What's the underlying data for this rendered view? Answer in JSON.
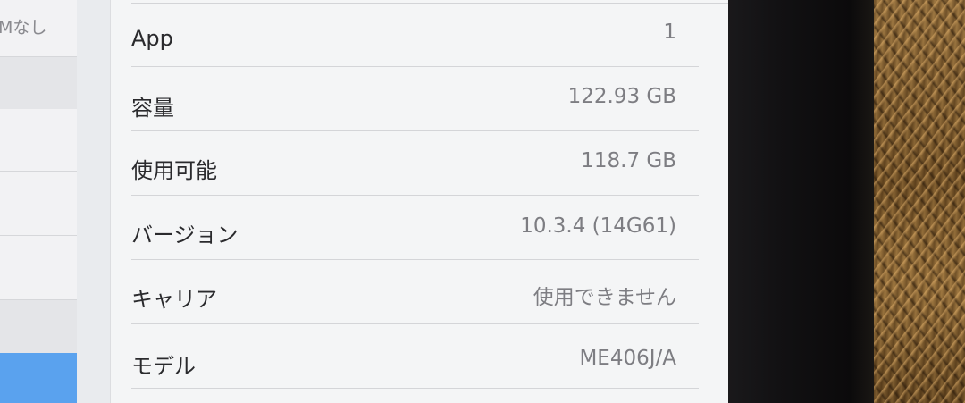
{
  "master_pane": {
    "visible_row_text": "Mなし"
  },
  "about": {
    "rows": [
      {
        "label": "App",
        "value": "1"
      },
      {
        "label": "容量",
        "value": "122.93 GB"
      },
      {
        "label": "使用可能",
        "value": "118.7 GB"
      },
      {
        "label": "バージョン",
        "value": "10.3.4 (14G61)"
      },
      {
        "label": "キャリア",
        "value": "使用できません"
      },
      {
        "label": "モデル",
        "value": "ME406J/A"
      }
    ]
  },
  "colors": {
    "selected_row": "#5aa2ee",
    "label_text": "#2a2a2d",
    "value_text": "#7d7d82",
    "group_background": "#f4f5f6"
  }
}
